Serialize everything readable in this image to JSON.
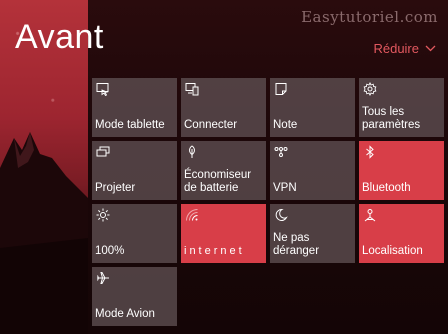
{
  "watermark": "Easytutoriel.com",
  "header": {
    "title": "Avant",
    "collapse_label": "Réduire"
  },
  "colors": {
    "accent": "#d83e48",
    "tile_inactive": "#5f5052",
    "collapse_text": "#e2585f"
  },
  "tiles": [
    {
      "label": "Mode tablette",
      "icon": "tablet-mode-icon",
      "active": false
    },
    {
      "label": "Connecter",
      "icon": "connect-icon",
      "active": false
    },
    {
      "label": "Note",
      "icon": "note-icon",
      "active": false
    },
    {
      "label": "Tous les paramètres",
      "icon": "gear-icon",
      "active": false
    },
    {
      "label": "Projeter",
      "icon": "project-icon",
      "active": false
    },
    {
      "label": "Économiseur de batterie",
      "icon": "battery-saver-icon",
      "active": false
    },
    {
      "label": "VPN",
      "icon": "vpn-icon",
      "active": false
    },
    {
      "label": "Bluetooth",
      "icon": "bluetooth-icon",
      "active": true
    },
    {
      "label": "100%",
      "icon": "brightness-icon",
      "active": false
    },
    {
      "label": "internet",
      "icon": "wifi-icon",
      "active": true
    },
    {
      "label": "Ne pas déranger",
      "icon": "moon-icon",
      "active": false
    },
    {
      "label": "Localisation",
      "icon": "location-icon",
      "active": true
    },
    {
      "label": "Mode Avion",
      "icon": "airplane-icon",
      "active": false
    }
  ]
}
